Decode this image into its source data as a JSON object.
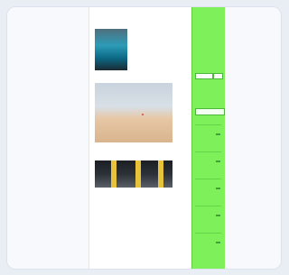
{
  "colors": {
    "sidebar_bg": "#7df05a",
    "link": "#5a9fd0",
    "accent": "#57b848"
  },
  "header": {
    "site_title": "",
    "top_link": "",
    "top_links_right": ""
  },
  "posts": [
    {
      "title": "",
      "text": "",
      "meta": ""
    },
    {
      "title": "",
      "text": "",
      "meta": ""
    },
    {
      "title": "",
      "text": "",
      "meta": ""
    }
  ],
  "sidebar": {
    "title_lines": [
      "",
      "",
      ""
    ],
    "search_placeholder": "",
    "search_button": "",
    "small_lines": [
      "",
      "",
      "",
      "",
      "",
      ""
    ]
  }
}
